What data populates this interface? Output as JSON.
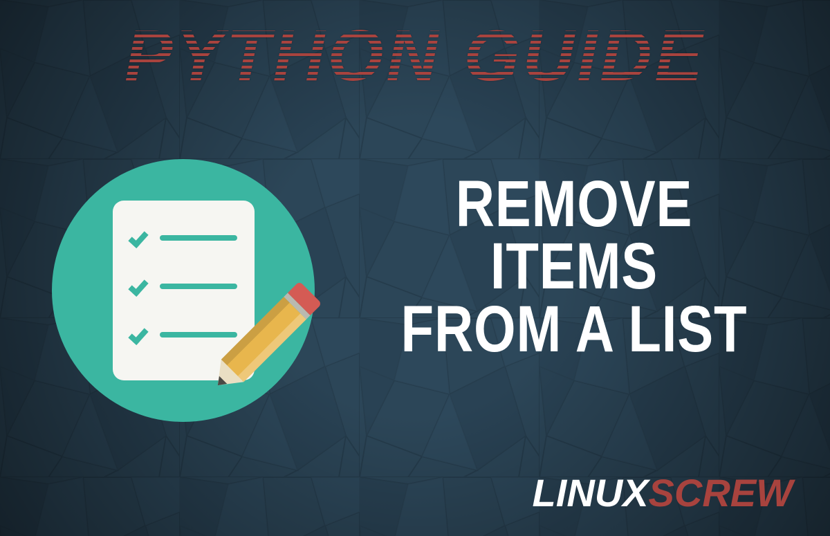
{
  "title_top": "PYTHON GUIDE",
  "headline": {
    "line1": "REMOVE ITEMS",
    "line2": "FROM A LIST"
  },
  "brand": {
    "part1": "LINUX",
    "part2": "SCREW"
  },
  "colors": {
    "background": "#2b4456",
    "accent_red": "#a8433e",
    "accent_teal": "#3bb6a1",
    "white": "#ffffff",
    "pencil_yellow": "#e8b64d"
  }
}
